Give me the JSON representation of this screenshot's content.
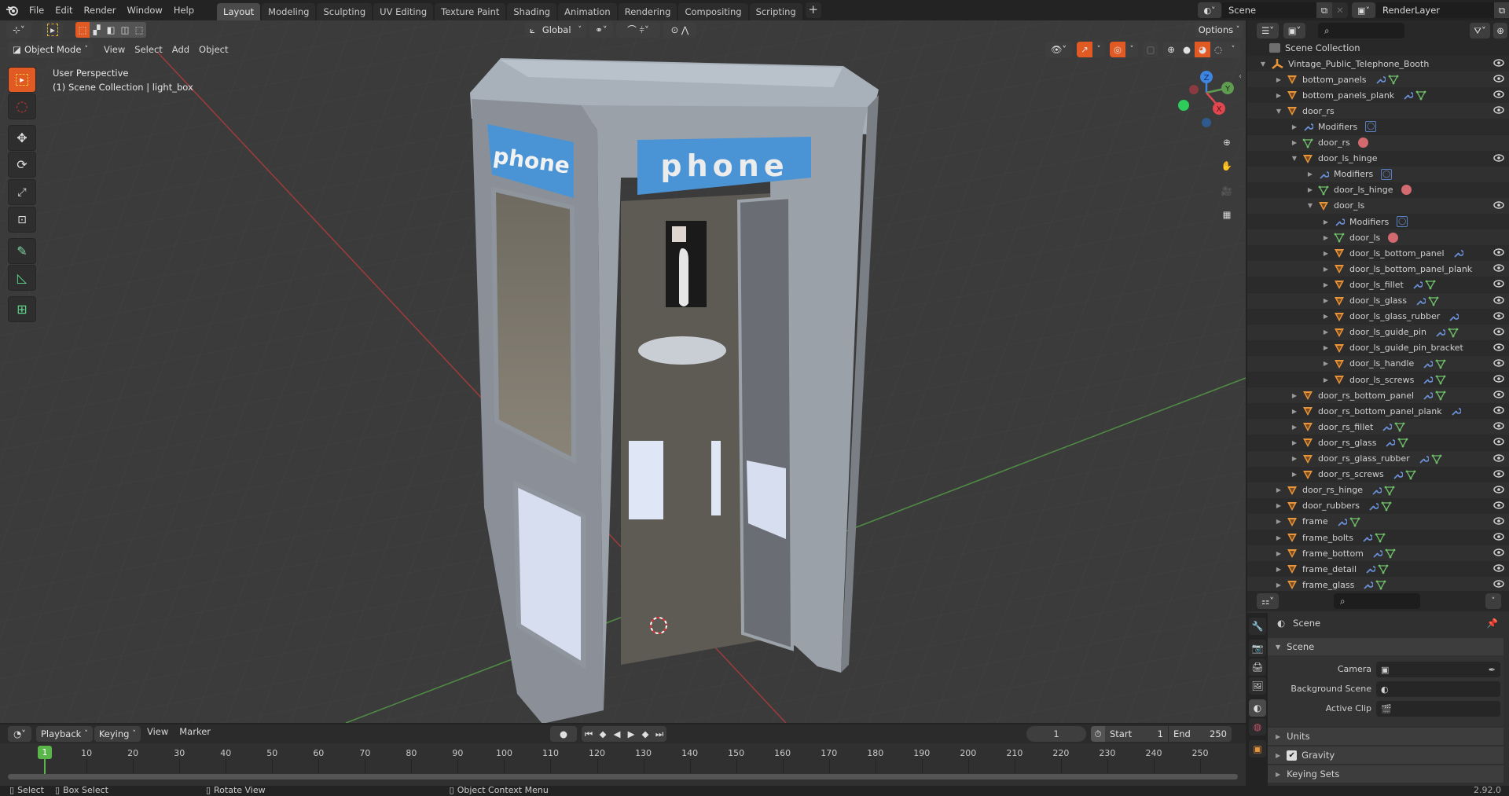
{
  "topbar": {
    "menus": [
      "File",
      "Edit",
      "Render",
      "Window",
      "Help"
    ],
    "workspaces": [
      {
        "label": "Layout",
        "active": true
      },
      {
        "label": "Modeling",
        "active": false
      },
      {
        "label": "Sculpting",
        "active": false
      },
      {
        "label": "UV Editing",
        "active": false
      },
      {
        "label": "Texture Paint",
        "active": false
      },
      {
        "label": "Shading",
        "active": false
      },
      {
        "label": "Animation",
        "active": false
      },
      {
        "label": "Rendering",
        "active": false
      },
      {
        "label": "Compositing",
        "active": false
      },
      {
        "label": "Scripting",
        "active": false
      }
    ],
    "add_workspace": "+",
    "scene_name": "Scene",
    "view_layer_name": "RenderLayer"
  },
  "viewport": {
    "mode": "Object Mode",
    "menus": [
      "View",
      "Select",
      "Add",
      "Object"
    ],
    "transform_orientation": "Global",
    "options_label": "Options",
    "overlay_text_line1": "User Perspective",
    "overlay_text_line2": "(1) Scene Collection | light_box",
    "sign_text_left": "phone",
    "sign_text_front": "phone",
    "gizmo": {
      "x": "X",
      "y": "Y",
      "z": "Z"
    },
    "colors": {
      "active_tool": "#e15a23",
      "x_axis": "#e0474f",
      "y_axis": "#6aa84f",
      "z_axis": "#3d85e0"
    }
  },
  "tools": [
    "select-box",
    "cursor",
    "move",
    "rotate",
    "scale",
    "transform",
    "annotate",
    "measure",
    "add-cube"
  ],
  "outliner": {
    "root": "Scene Collection",
    "rows": [
      {
        "depth": 0,
        "name": "Vintage_Public_Telephone_Booth",
        "type": "empty",
        "expanded": true,
        "eye": true,
        "mod": false,
        "mesh": false
      },
      {
        "depth": 1,
        "name": "bottom_panels",
        "type": "object",
        "expanded": false,
        "eye": true,
        "mod": true,
        "mesh": true
      },
      {
        "depth": 1,
        "name": "bottom_panels_plank",
        "type": "object",
        "expanded": false,
        "eye": true,
        "mod": true,
        "mesh": true
      },
      {
        "depth": 1,
        "name": "door_rs",
        "type": "object",
        "expanded": true,
        "eye": true,
        "mod": false,
        "mesh": false
      },
      {
        "depth": 2,
        "name": "Modifiers",
        "type": "modifiers",
        "expanded": false,
        "eye": false,
        "mod": false,
        "mesh": false,
        "badge": "modifier"
      },
      {
        "depth": 2,
        "name": "door_rs",
        "type": "mesh",
        "expanded": false,
        "eye": false,
        "mod": false,
        "mesh": false,
        "badge": "material"
      },
      {
        "depth": 2,
        "name": "door_ls_hinge",
        "type": "object",
        "expanded": true,
        "eye": true,
        "mod": false,
        "mesh": false
      },
      {
        "depth": 3,
        "name": "Modifiers",
        "type": "modifiers",
        "expanded": false,
        "eye": false,
        "mod": false,
        "mesh": false,
        "badge": "modifier"
      },
      {
        "depth": 3,
        "name": "door_ls_hinge",
        "type": "mesh",
        "expanded": false,
        "eye": false,
        "mod": false,
        "mesh": false,
        "badge": "material"
      },
      {
        "depth": 3,
        "name": "door_ls",
        "type": "object",
        "expanded": true,
        "eye": true,
        "mod": false,
        "mesh": false
      },
      {
        "depth": 4,
        "name": "Modifiers",
        "type": "modifiers",
        "expanded": false,
        "eye": false,
        "mod": false,
        "mesh": false,
        "badge": "modifier"
      },
      {
        "depth": 4,
        "name": "door_ls",
        "type": "mesh",
        "expanded": false,
        "eye": false,
        "mod": false,
        "mesh": false,
        "badge": "material"
      },
      {
        "depth": 4,
        "name": "door_ls_bottom_panel",
        "type": "object",
        "expanded": false,
        "eye": true,
        "mod": true,
        "mesh": false
      },
      {
        "depth": 4,
        "name": "door_ls_bottom_panel_plank",
        "type": "object",
        "expanded": false,
        "eye": true,
        "mod": false,
        "mesh": false
      },
      {
        "depth": 4,
        "name": "door_ls_fillet",
        "type": "object",
        "expanded": false,
        "eye": true,
        "mod": true,
        "mesh": true
      },
      {
        "depth": 4,
        "name": "door_ls_glass",
        "type": "object",
        "expanded": false,
        "eye": true,
        "mod": true,
        "mesh": true
      },
      {
        "depth": 4,
        "name": "door_ls_glass_rubber",
        "type": "object",
        "expanded": false,
        "eye": true,
        "mod": true,
        "mesh": false
      },
      {
        "depth": 4,
        "name": "door_ls_guide_pin",
        "type": "object",
        "expanded": false,
        "eye": true,
        "mod": true,
        "mesh": true
      },
      {
        "depth": 4,
        "name": "door_ls_guide_pin_bracket",
        "type": "object",
        "expanded": false,
        "eye": true,
        "mod": false,
        "mesh": false
      },
      {
        "depth": 4,
        "name": "door_ls_handle",
        "type": "object",
        "expanded": false,
        "eye": true,
        "mod": true,
        "mesh": true
      },
      {
        "depth": 4,
        "name": "door_ls_screws",
        "type": "object",
        "expanded": false,
        "eye": true,
        "mod": true,
        "mesh": true
      },
      {
        "depth": 2,
        "name": "door_rs_bottom_panel",
        "type": "object",
        "expanded": false,
        "eye": true,
        "mod": true,
        "mesh": true
      },
      {
        "depth": 2,
        "name": "door_rs_bottom_panel_plank",
        "type": "object",
        "expanded": false,
        "eye": true,
        "mod": true,
        "mesh": false
      },
      {
        "depth": 2,
        "name": "door_rs_fillet",
        "type": "object",
        "expanded": false,
        "eye": true,
        "mod": true,
        "mesh": true
      },
      {
        "depth": 2,
        "name": "door_rs_glass",
        "type": "object",
        "expanded": false,
        "eye": true,
        "mod": true,
        "mesh": true
      },
      {
        "depth": 2,
        "name": "door_rs_glass_rubber",
        "type": "object",
        "expanded": false,
        "eye": true,
        "mod": true,
        "mesh": true
      },
      {
        "depth": 2,
        "name": "door_rs_screws",
        "type": "object",
        "expanded": false,
        "eye": true,
        "mod": true,
        "mesh": true
      },
      {
        "depth": 1,
        "name": "door_rs_hinge",
        "type": "object",
        "expanded": false,
        "eye": true,
        "mod": true,
        "mesh": true
      },
      {
        "depth": 1,
        "name": "door_rubbers",
        "type": "object",
        "expanded": false,
        "eye": true,
        "mod": true,
        "mesh": true
      },
      {
        "depth": 1,
        "name": "frame",
        "type": "object",
        "expanded": false,
        "eye": true,
        "mod": true,
        "mesh": true
      },
      {
        "depth": 1,
        "name": "frame_bolts",
        "type": "object",
        "expanded": false,
        "eye": true,
        "mod": true,
        "mesh": true
      },
      {
        "depth": 1,
        "name": "frame_bottom",
        "type": "object",
        "expanded": false,
        "eye": true,
        "mod": true,
        "mesh": true
      },
      {
        "depth": 1,
        "name": "frame_detail",
        "type": "object",
        "expanded": false,
        "eye": true,
        "mod": true,
        "mesh": true
      },
      {
        "depth": 1,
        "name": "frame_glass",
        "type": "object",
        "expanded": false,
        "eye": true,
        "mod": true,
        "mesh": true
      }
    ]
  },
  "properties": {
    "context_title": "Scene",
    "panel_title": "Scene",
    "fields": [
      {
        "label": "Camera",
        "value": ""
      },
      {
        "label": "Background Scene",
        "value": ""
      },
      {
        "label": "Active Clip",
        "value": ""
      }
    ],
    "subpanels": [
      {
        "label": "Units",
        "checkbox": false
      },
      {
        "label": "Gravity",
        "checkbox": true,
        "checked": true
      },
      {
        "label": "Keying Sets",
        "checkbox": false
      }
    ],
    "tabs": [
      "tool",
      "render",
      "output",
      "view-layer",
      "scene",
      "world",
      "object"
    ],
    "active_tab": "scene"
  },
  "timeline": {
    "menus": [
      "Playback",
      "Keying",
      "View",
      "Marker"
    ],
    "current_frame": "1",
    "start_label": "Start",
    "start": "1",
    "end_label": "End",
    "end": "250",
    "ticks": [
      "10",
      "20",
      "30",
      "40",
      "50",
      "60",
      "70",
      "80",
      "90",
      "100",
      "110",
      "120",
      "130",
      "140",
      "150",
      "160",
      "170",
      "180",
      "190",
      "200",
      "210",
      "220",
      "230",
      "240",
      "250"
    ],
    "playhead": "1"
  },
  "statusbar": {
    "items": [
      "Select",
      "Box Select",
      "Rotate View",
      "Object Context Menu"
    ],
    "version": "2.92.0"
  }
}
